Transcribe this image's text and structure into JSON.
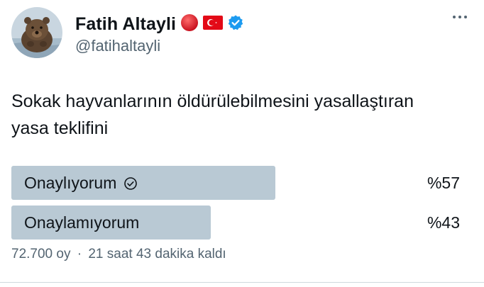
{
  "author": {
    "display_name": "Fatih Altayli",
    "handle": "@fatihaltayli",
    "avatar_icon": "bear-photo-avatar",
    "badges": [
      "red-circle-emoji",
      "turkey-flag-emoji",
      "verified-badge-icon"
    ]
  },
  "tweet": {
    "text_line1": "Sokak hayvanlarının öldürülebilmesini yasallaştıran",
    "text_line2": "yasa teklifini"
  },
  "poll": {
    "options": [
      {
        "label": "Onaylıyorum",
        "percent_text": "%57",
        "percent": 57,
        "selected": true
      },
      {
        "label": "Onaylamıyorum",
        "percent_text": "%43",
        "percent": 43,
        "selected": false
      }
    ],
    "votes": "72.700 oy",
    "separator": "·",
    "time_left": "21 saat 43 dakika kaldı"
  },
  "colors": {
    "bar": "#b9c9d4",
    "verified": "#1d9bf0",
    "secondary_text": "#536471"
  }
}
